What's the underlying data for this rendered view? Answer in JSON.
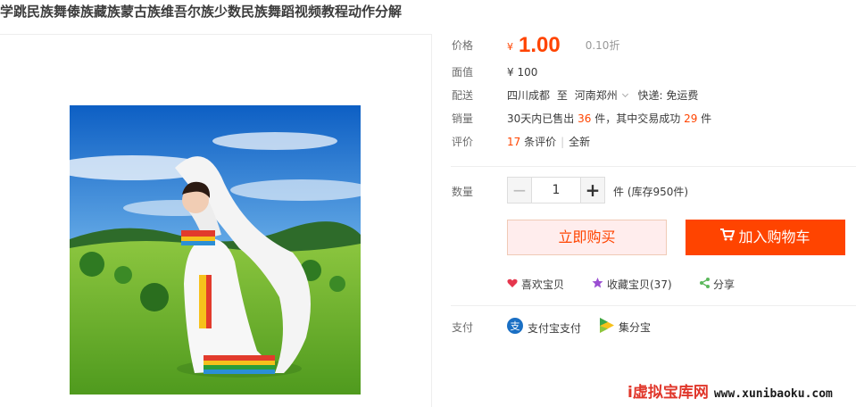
{
  "product": {
    "title": "学跳民族舞傣族藏族蒙古族维吾尔族少数民族舞蹈视频教程动作分解"
  },
  "price": {
    "label": "价格",
    "currency": "¥",
    "value": "1.00",
    "discount": "0.10折"
  },
  "face_value": {
    "label": "面值",
    "value": "¥ 100"
  },
  "shipping": {
    "label": "配送",
    "from": "四川成都",
    "to_word": "至",
    "destination": "河南郑州",
    "method": "快递: 免运费"
  },
  "sales": {
    "label": "销量",
    "prefix": "30天内已售出",
    "sold": "36",
    "mid": "件，其中交易成功",
    "success": "29",
    "suffix": "件"
  },
  "reviews": {
    "label": "评价",
    "count": "17",
    "count_suffix": "条评价",
    "sep": "|",
    "link": "全新"
  },
  "quantity": {
    "label": "数量",
    "minus": "−",
    "value": "1",
    "plus": "+",
    "stock": "件 (库存950件)"
  },
  "actions": {
    "buy_now": "立即购买",
    "add_to_cart": "加入购物车"
  },
  "social": {
    "like": "喜欢宝贝",
    "favorite": "收藏宝贝(37)",
    "share": "分享"
  },
  "payment": {
    "label": "支付",
    "alipay": "支付宝支付",
    "jifenbao": "集分宝"
  },
  "watermark": {
    "brand": "i虚拟宝库网",
    "url": "www.xunibaoku.com"
  },
  "colors": {
    "accent": "#ff4400",
    "buy_bg": "#ffeded",
    "heart": "#e5364d",
    "star": "#9a4ed2",
    "share": "#5cb85c"
  }
}
